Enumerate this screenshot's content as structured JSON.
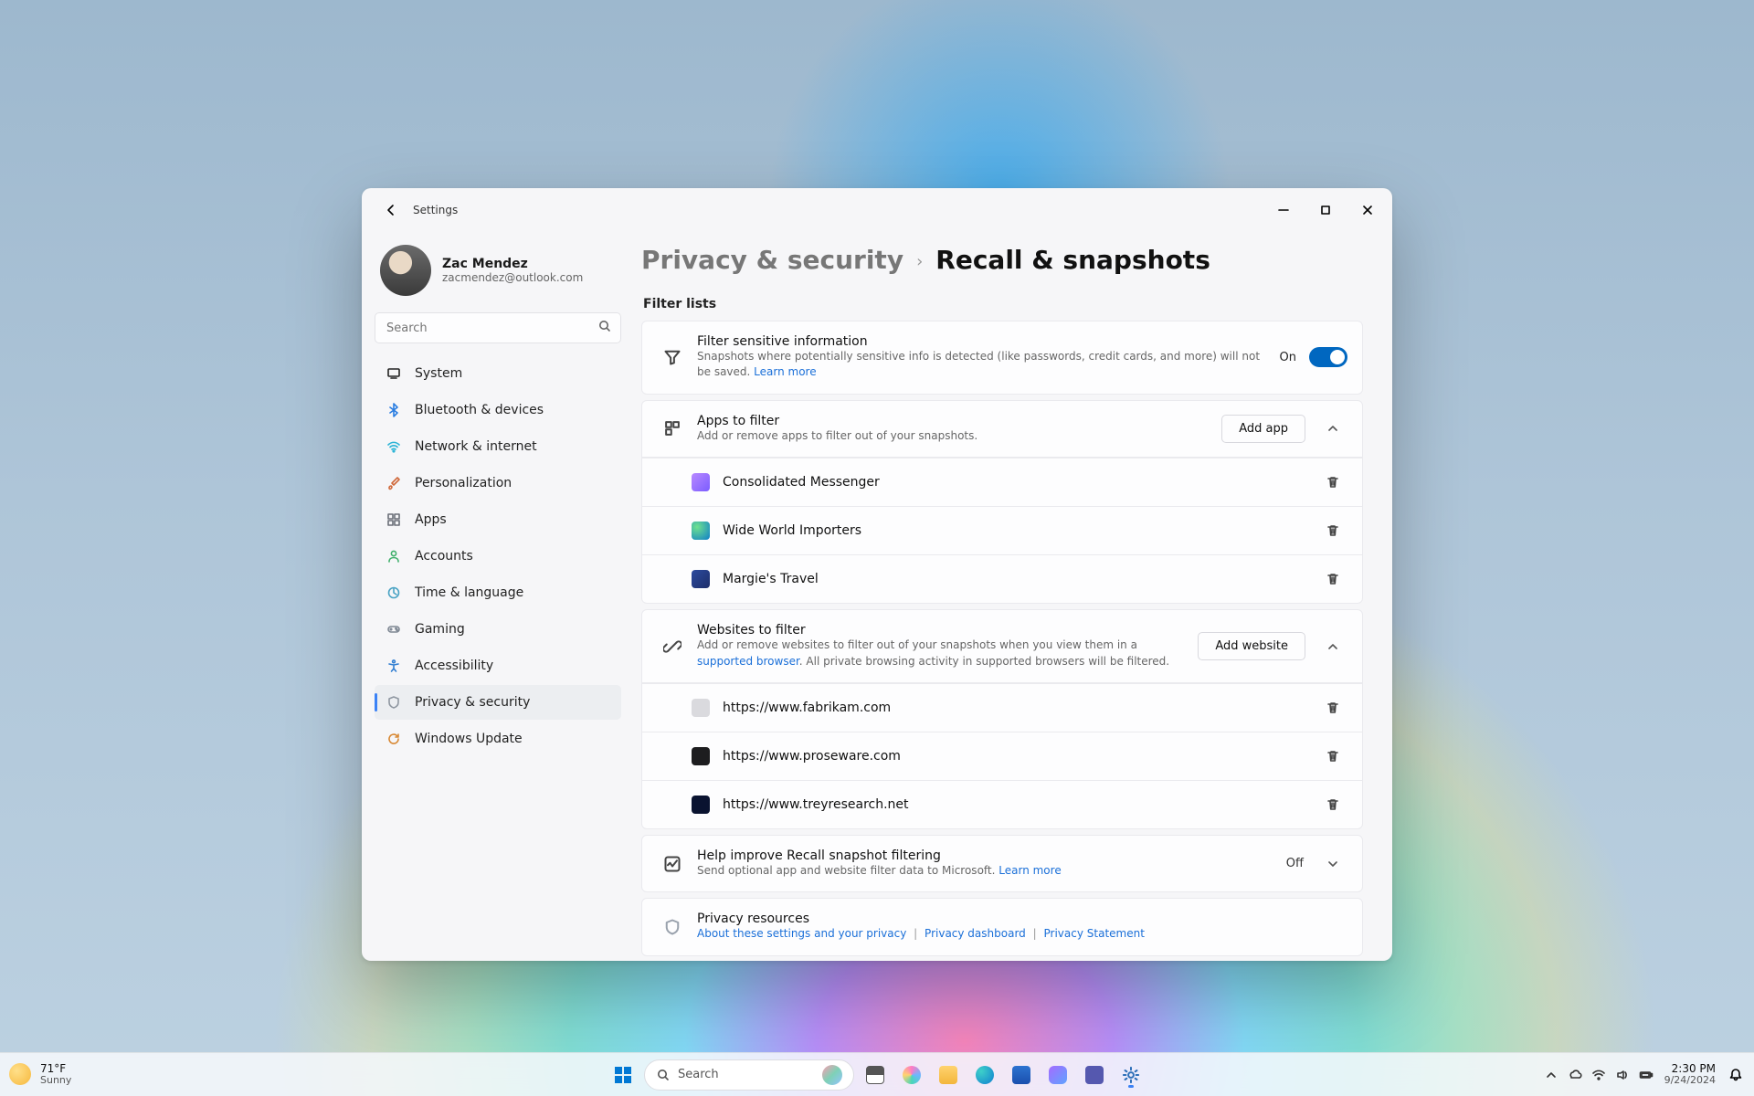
{
  "window": {
    "title": "Settings"
  },
  "profile": {
    "name": "Zac Mendez",
    "email": "zacmendez@outlook.com"
  },
  "search": {
    "placeholder": "Search"
  },
  "nav": {
    "system": "System",
    "bluetooth": "Bluetooth & devices",
    "network": "Network & internet",
    "personalization": "Personalization",
    "apps": "Apps",
    "accounts": "Accounts",
    "time": "Time & language",
    "gaming": "Gaming",
    "accessibility": "Accessibility",
    "privacy": "Privacy & security",
    "update": "Windows Update"
  },
  "breadcrumb": {
    "parent": "Privacy & security",
    "current": "Recall & snapshots"
  },
  "section": {
    "filter_lists": "Filter lists"
  },
  "sensitive": {
    "title": "Filter sensitive information",
    "desc": "Snapshots where potentially sensitive info is detected (like passwords, credit cards, and more) will not be saved. ",
    "learn_more": "Learn more",
    "state": "On"
  },
  "apps_filter": {
    "title": "Apps to filter",
    "desc": "Add or remove apps to filter out of your snapshots.",
    "add_button": "Add app",
    "items": [
      "Consolidated Messenger",
      "Wide World Importers",
      "Margie's Travel"
    ]
  },
  "websites_filter": {
    "title": "Websites to filter",
    "desc_a": "Add or remove websites to filter out of your snapshots when you view them in a ",
    "link": "supported browser",
    "desc_b": ". All private browsing activity in supported browsers will be filtered.",
    "add_button": "Add website",
    "items": [
      "https://www.fabrikam.com",
      "https://www.proseware.com",
      "https://www.treyresearch.net"
    ]
  },
  "help_improve": {
    "title": "Help improve Recall snapshot filtering",
    "desc": "Send optional app and website filter data to Microsoft. ",
    "learn_more": "Learn more",
    "state": "Off"
  },
  "resources": {
    "title": "Privacy resources",
    "a": "About these settings and your privacy",
    "b": "Privacy dashboard",
    "c": "Privacy Statement"
  },
  "taskbar": {
    "weather_temp": "71°F",
    "weather_desc": "Sunny",
    "search": "Search",
    "time": "2:30 PM",
    "date": "9/24/2024"
  }
}
